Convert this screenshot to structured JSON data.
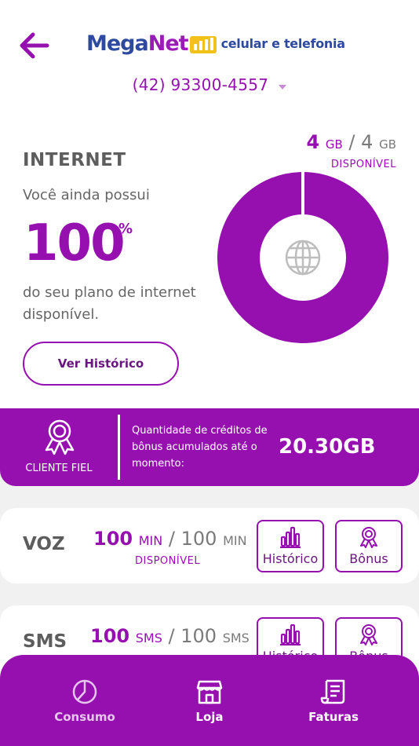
{
  "header": {
    "brand_mega": "Mega",
    "brand_net": "Net",
    "brand_tagline": "celular e telefonia",
    "phone": "(42) 93300-4557"
  },
  "internet": {
    "title": "INTERNET",
    "subtitle": "Você ainda possui",
    "percent": "100",
    "percent_sign": "%",
    "description": "do seu plano de internet disponível.",
    "history_button": "Ver Histórico",
    "available": "4",
    "available_unit": "GB",
    "separator": "/",
    "total": "4",
    "total_unit": "GB",
    "available_label": "DISPONÍVEL",
    "donut_fraction_available": 1.0,
    "donut_center_icon": "globe-icon"
  },
  "loyalty": {
    "label": "CLIENTE FIEL",
    "description": "Quantidade de créditos de bônus acumulados até o momento:",
    "value": "20.30GB",
    "icon": "ribbon-award-icon"
  },
  "voice": {
    "title": "VOZ",
    "available": "100",
    "available_unit": "MIN",
    "separator": "/",
    "total": "100",
    "total_unit": "MIN",
    "available_label": "DISPONÍVEL",
    "history_button": "Histórico",
    "bonus_button": "Bônus"
  },
  "sms": {
    "title": "SMS",
    "available": "100",
    "available_unit": "SMS",
    "separator": "/",
    "total": "100",
    "total_unit": "SMS",
    "history_button": "Histórico",
    "bonus_button": "Bônus"
  },
  "nav": {
    "items": [
      {
        "label": "Consumo",
        "icon": "pie-chart-icon"
      },
      {
        "label": "Loja",
        "icon": "store-icon"
      },
      {
        "label": "Faturas",
        "icon": "receipt-icon"
      }
    ]
  },
  "colors": {
    "primary": "#9610b0",
    "brand_blue": "#2e4aa0",
    "brand_yellow": "#f2c21b"
  }
}
